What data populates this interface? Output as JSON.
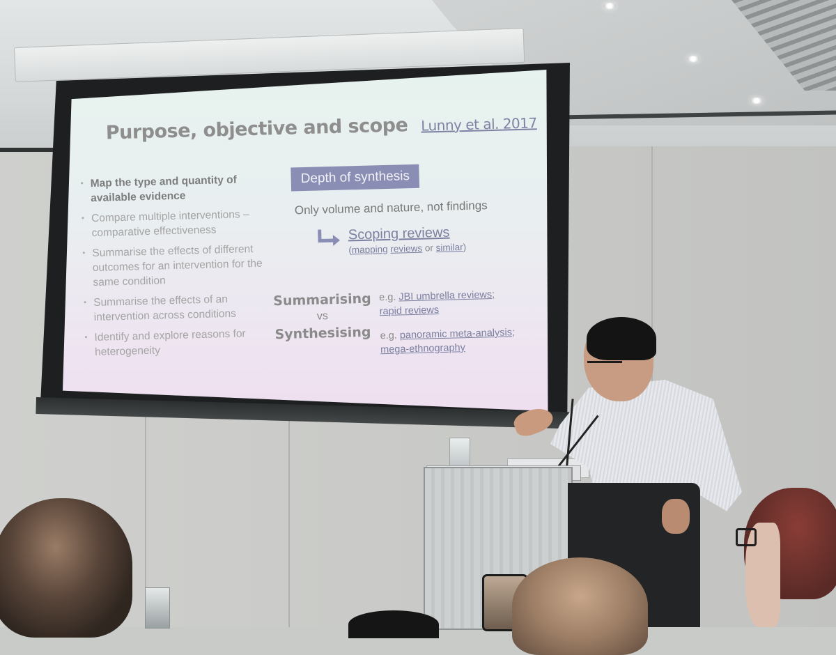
{
  "scene": {
    "description": "Conference presentation: a speaker at a podium points at a projected slide",
    "colors": {
      "slide_accent": "#8a8db4",
      "link_text": "#7b7fa0",
      "title_text": "#8e8e8e",
      "body_text": "#a4a4a4",
      "slide_bg_top": "#e7f3ef",
      "slide_bg_bottom": "#efdff0"
    }
  },
  "slide": {
    "title": "Purpose, objective and scope",
    "citation": "Lunny et al. 2017",
    "bullets": [
      {
        "text": "Map the type and quantity of available evidence",
        "emphasis": true
      },
      {
        "text": "Compare multiple interventions – comparative effectiveness",
        "emphasis": false
      },
      {
        "text": "Summarise the effects of different outcomes for an intervention for the same condition",
        "emphasis": false
      },
      {
        "text": "Summarise the effects of an intervention across conditions",
        "emphasis": false
      },
      {
        "text": "Identify and explore reasons for heterogeneity",
        "emphasis": false
      }
    ],
    "depth_label": "Depth of synthesis",
    "depth_note": "Only volume and nature, not findings",
    "arrow_icon": "turn-right-arrow-icon",
    "scoping": {
      "label": "Scoping reviews",
      "open_paren": "(",
      "mapping": "mapping",
      "reviews": "reviews",
      "or": " or ",
      "similar": "similar",
      "close_paren": ")"
    },
    "comparison": {
      "top": "Summarising",
      "vs": "vs",
      "bottom": "Synthesising"
    },
    "examples": [
      {
        "prefix": "e.g. ",
        "link1": "JBI umbrella reviews",
        "sep": ";",
        "link2": "rapid reviews"
      },
      {
        "prefix": "e.g. ",
        "link1": "panoramic meta-analysis",
        "sep": ";",
        "link2": "mega-ethnography"
      }
    ]
  }
}
